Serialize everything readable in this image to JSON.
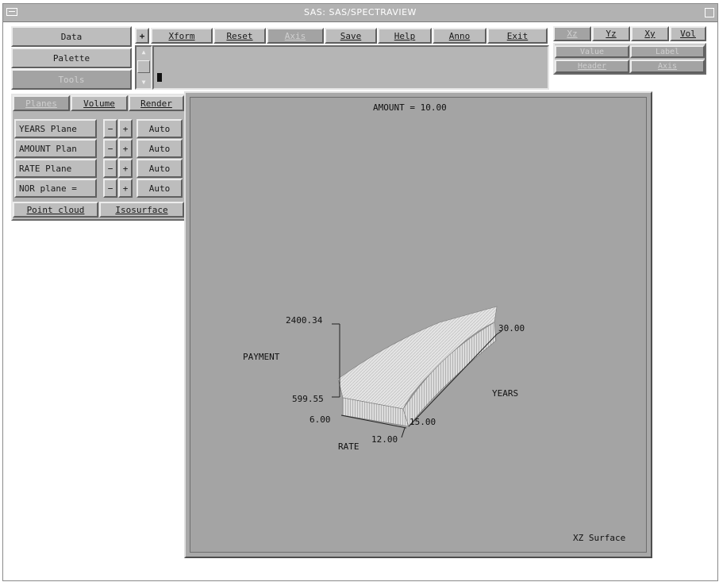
{
  "window": {
    "title": "SAS: SAS/SPECTRAVIEW"
  },
  "left_menu": {
    "data": "Data",
    "palette": "Palette",
    "tools": "Tools"
  },
  "toolbar": {
    "plus": "+",
    "xform": "Xform",
    "reset": "Reset",
    "axis": "Axis",
    "save": "Save",
    "help": "Help",
    "anno": "Anno",
    "exit": "Exit"
  },
  "view_tabs": {
    "xz": "Xz",
    "yz": "Yz",
    "xy": "Xy",
    "vol": "Vol"
  },
  "display_opts": {
    "value": "Value",
    "label": "Label",
    "header": "Header",
    "axis": "Axis"
  },
  "tool_tabs": {
    "planes": "Planes",
    "volume": "Volume",
    "render": "Render"
  },
  "planes": [
    {
      "label": "YEARS Plane",
      "minus": "−",
      "plus": "+",
      "auto": "Auto"
    },
    {
      "label": "AMOUNT Plan",
      "minus": "−",
      "plus": "+",
      "auto": "Auto"
    },
    {
      "label": "RATE Plane",
      "minus": "−",
      "plus": "+",
      "auto": "Auto"
    },
    {
      "label": "NOR plane =",
      "minus": "−",
      "plus": "+",
      "auto": "Auto"
    }
  ],
  "render_modes": {
    "point_cloud": "Point cloud",
    "isosurface": "Isosurface"
  },
  "chart": {
    "header": "AMOUNT = 10.00",
    "footer": "XZ Surface",
    "payment_label": "PAYMENT",
    "years_label": "YEARS",
    "rate_label": "RATE",
    "payment_max": "2400.34",
    "payment_min": "599.55",
    "rate_min": "6.00",
    "rate_max": "12.00",
    "years_min": "15.00",
    "years_max": "30.00",
    "colors": {
      "background": "#a4a4a4",
      "surface_light": "#e2e2e2",
      "surface_side": "#dcdcdc"
    }
  }
}
